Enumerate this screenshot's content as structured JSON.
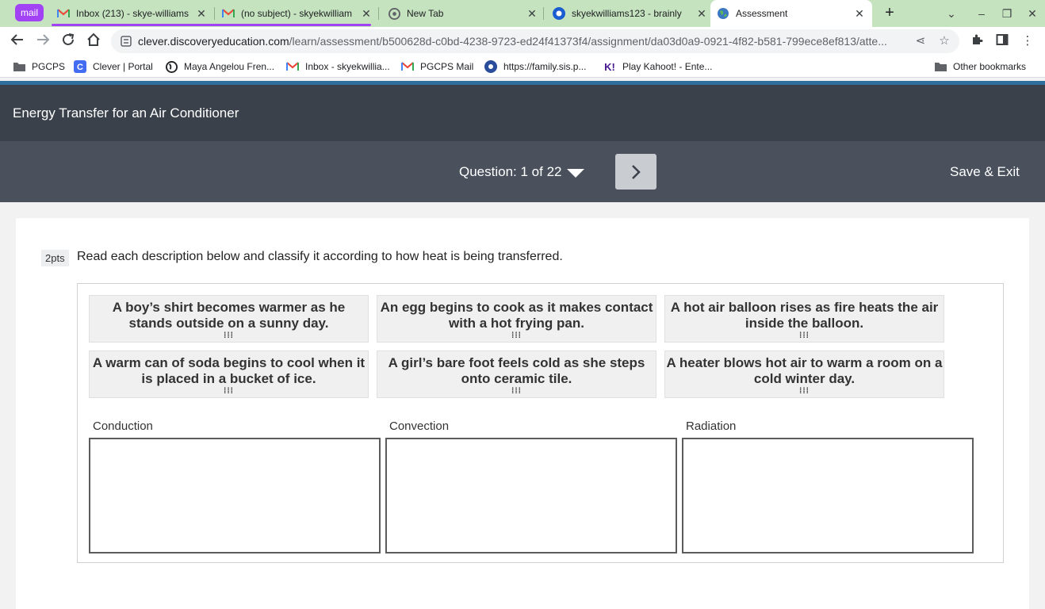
{
  "browser": {
    "tab_group_label": "mail",
    "tabs": [
      {
        "title": "Inbox (213) - skye-williams",
        "icon": "gmail-icon"
      },
      {
        "title": "(no subject) - skyekwilliam",
        "icon": "gmail-icon"
      },
      {
        "title": "New Tab",
        "icon": "chrome-icon"
      },
      {
        "title": "skyekwilliams123 - brainly",
        "icon": "brainly-icon"
      },
      {
        "title": "Assessment",
        "icon": "globe-icon"
      }
    ],
    "url_host": "clever.discoveryeducation.com",
    "url_path": "/learn/assessment/b500628d-c0bd-4238-9723-ed24f41373f4/assignment/da03d0a9-0921-4f82-b581-799ece8ef813/atte...",
    "bookmarks": [
      {
        "label": "PGCPS",
        "icon": "folder-icon"
      },
      {
        "label": "Clever | Portal",
        "icon": "clever-icon"
      },
      {
        "label": "Maya Angelou Fren...",
        "icon": "globe-icon"
      },
      {
        "label": "Inbox - skyekwillia...",
        "icon": "gmail-icon"
      },
      {
        "label": "PGCPS Mail",
        "icon": "gmail-icon"
      },
      {
        "label": "https://family.sis.p...",
        "icon": "sis-icon"
      },
      {
        "label": "Play Kahoot! - Ente...",
        "icon": "kahoot-icon"
      }
    ],
    "other_bookmarks": "Other bookmarks"
  },
  "header": {
    "title": "Energy Transfer for an Air Conditioner",
    "question_label": "Question: 1 of 22",
    "save_exit": "Save & Exit"
  },
  "question": {
    "points": "2pts",
    "prompt": "Read each description below and classify it according to how heat is being transferred.",
    "tiles": [
      "A boy’s shirt becomes warmer as he stands outside on a sunny day.",
      "An egg begins to cook as it makes contact with a hot frying pan.",
      "A hot air balloon rises as fire heats the air inside the balloon.",
      "A warm can of soda begins to cool when it is placed in a bucket of ice.",
      "A girl’s bare foot feels cold as she steps onto ceramic tile.",
      "A heater blows hot air to warm a room on a cold winter day."
    ],
    "categories": [
      "Conduction",
      "Convection",
      "Radiation"
    ]
  },
  "colors": {
    "tab_strip": "#c5e3bf",
    "tab_group": "#a142f4",
    "header_dark": "#3a414b",
    "question_bar": "#4a515d",
    "accent_strip": "#2f6f9e"
  }
}
